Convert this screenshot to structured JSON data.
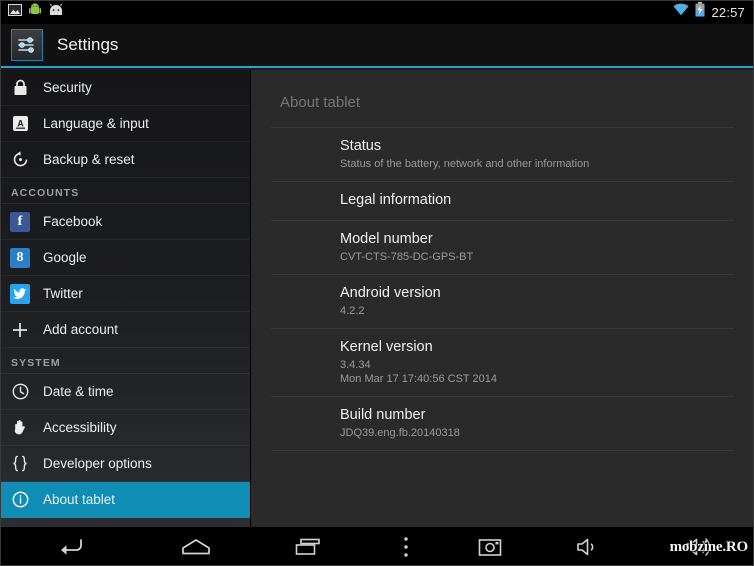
{
  "statusbar": {
    "left_icons": [
      "screenshot-icon",
      "android-figure-icon",
      "android-head-icon"
    ],
    "wifi_icon": "wifi-icon",
    "battery_icon": "battery-charging-icon",
    "clock": "22:57"
  },
  "actionbar": {
    "app_icon": "settings-sliders-icon",
    "title": "Settings",
    "accent_color": "#2f9fd0"
  },
  "sidebar": {
    "selected_color": "#0f8db4",
    "items": [
      {
        "type": "item",
        "icon": "lock-icon",
        "label": "Security",
        "selected": false
      },
      {
        "type": "item",
        "icon": "language-a-icon",
        "label": "Language & input",
        "selected": false
      },
      {
        "type": "item",
        "icon": "backup-restore-icon",
        "label": "Backup & reset",
        "selected": false
      },
      {
        "type": "header",
        "label": "ACCOUNTS"
      },
      {
        "type": "item",
        "icon": "facebook-icon",
        "label": "Facebook",
        "selected": false
      },
      {
        "type": "item",
        "icon": "google-icon",
        "label": "Google",
        "selected": false
      },
      {
        "type": "item",
        "icon": "twitter-icon",
        "label": "Twitter",
        "selected": false
      },
      {
        "type": "item",
        "icon": "plus-icon",
        "label": "Add account",
        "selected": false
      },
      {
        "type": "header",
        "label": "SYSTEM"
      },
      {
        "type": "item",
        "icon": "clock-icon",
        "label": "Date & time",
        "selected": false
      },
      {
        "type": "item",
        "icon": "hand-icon",
        "label": "Accessibility",
        "selected": false
      },
      {
        "type": "item",
        "icon": "braces-icon",
        "label": "Developer options",
        "selected": false
      },
      {
        "type": "item",
        "icon": "info-circle-icon",
        "label": "About tablet",
        "selected": true
      }
    ]
  },
  "main": {
    "title": "About tablet",
    "rows": [
      {
        "title": "Status",
        "sub": "Status of the battery, network and other information"
      },
      {
        "title": "Legal information",
        "sub": ""
      },
      {
        "title": "Model number",
        "sub": "CVT-CTS-785-DC-GPS-BT"
      },
      {
        "title": "Android version",
        "sub": "4.2.2"
      },
      {
        "title": "Kernel version",
        "sub": "3.4.34\nMon Mar 17 17:40:56 CST 2014"
      },
      {
        "title": "Build number",
        "sub": "JDQ39.eng.fb.20140318"
      }
    ]
  },
  "navbar": {
    "buttons": [
      {
        "icon": "back-icon",
        "label": "Back"
      },
      {
        "icon": "home-icon",
        "label": "Home"
      },
      {
        "icon": "recents-icon",
        "label": "Recent apps"
      },
      {
        "icon": "menu-dots-icon",
        "label": "Menu"
      },
      {
        "icon": "camera-icon",
        "label": "Screenshot"
      },
      {
        "icon": "volume-down-icon",
        "label": "Volume down"
      },
      {
        "icon": "volume-up-icon",
        "label": "Volume up"
      }
    ],
    "watermark": "mobzine.RO"
  }
}
